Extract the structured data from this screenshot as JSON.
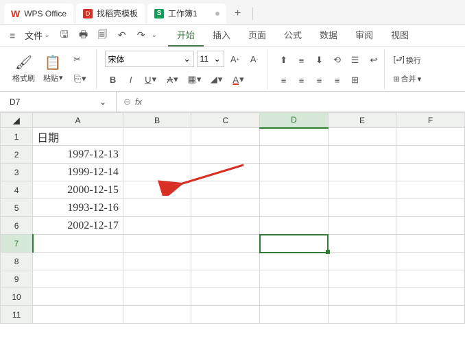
{
  "titlebar": {
    "office_label": "WPS Office",
    "template_label": "找稻壳模板",
    "workbook_label": "工作簿1",
    "add_label": "+"
  },
  "menubar": {
    "file_label": "文件",
    "tabs": [
      "开始",
      "插入",
      "页面",
      "公式",
      "数据",
      "审阅",
      "视图"
    ],
    "active_tab": "开始"
  },
  "ribbon": {
    "format_painter": "格式刷",
    "paste": "粘贴",
    "font_name": "宋体",
    "font_size": "11",
    "wrap_text": "换行",
    "merge": "合并"
  },
  "fxbar": {
    "namebox": "D7",
    "fx_label": "fx",
    "formula": ""
  },
  "grid": {
    "columns": [
      "A",
      "B",
      "C",
      "D",
      "E",
      "F"
    ],
    "rows": [
      "1",
      "2",
      "3",
      "4",
      "5",
      "6",
      "7",
      "8",
      "9",
      "10",
      "11"
    ],
    "selected_col": "D",
    "selected_row": "7",
    "cells": {
      "A1": "日期",
      "A2": "1997-12-13",
      "A3": "1999-12-14",
      "A4": "2000-12-15",
      "A5": "1993-12-16",
      "A6": "2002-12-17"
    }
  }
}
